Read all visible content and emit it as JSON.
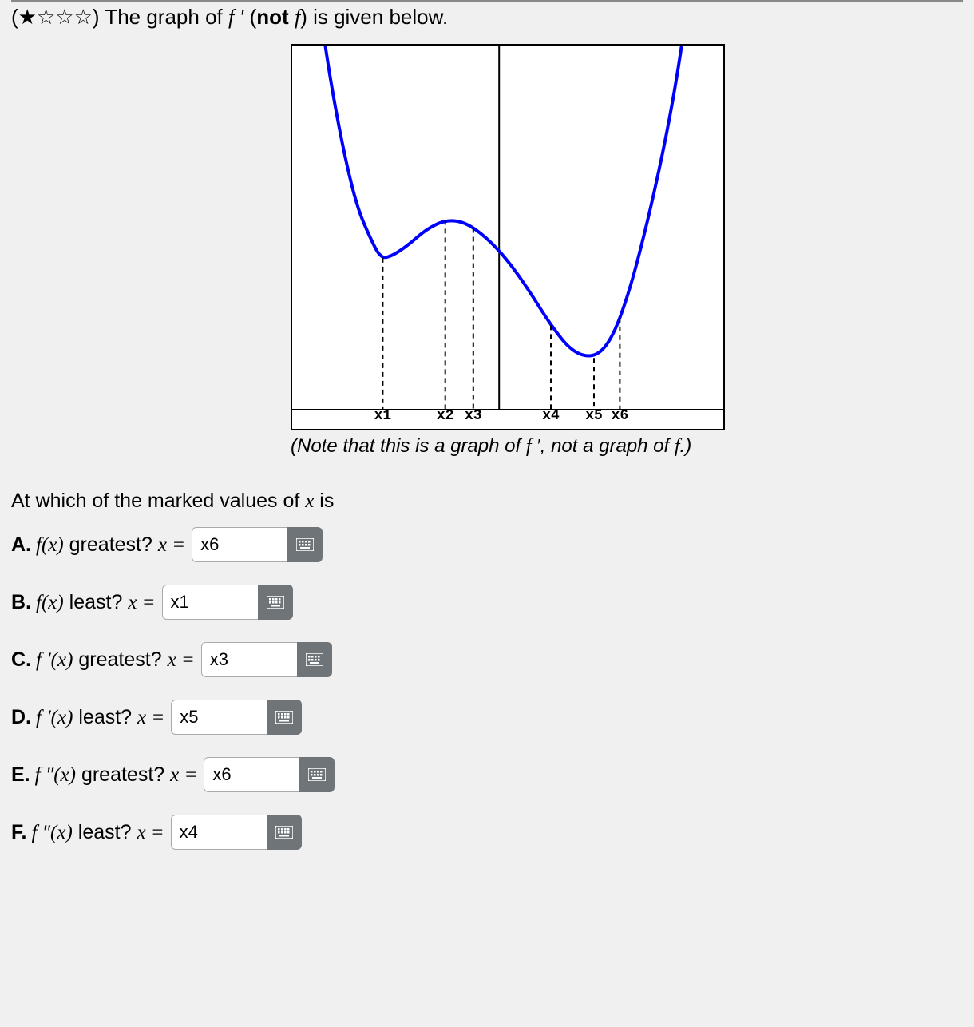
{
  "prompt": {
    "stars": "(★☆☆☆)",
    "text_pre": " The graph of ",
    "fprime": "f ′",
    "text_mid": " (",
    "not": "not",
    "text_mid2": " ",
    "f": "f",
    "text_post": ") is given below."
  },
  "caption": {
    "pre": "(Note that this is a graph of ",
    "f1": "f ′",
    "mid": ", not a graph of ",
    "f2": "f",
    "post": ".)"
  },
  "xlabels": [
    "x1",
    "x2",
    "x3",
    "x4",
    "x5",
    "x6"
  ],
  "lead": {
    "pre": "At which of the marked values of ",
    "var": "x",
    "post": " is"
  },
  "questions": [
    {
      "letter": "A.",
      "func": "f(x)",
      "ask": "greatest?",
      "eq": "x =",
      "value": "x6"
    },
    {
      "letter": "B.",
      "func": "f(x)",
      "ask": "least?",
      "eq": "x =",
      "value": "x1"
    },
    {
      "letter": "C.",
      "func": "f ′(x)",
      "ask": "greatest?",
      "eq": "x =",
      "value": "x3"
    },
    {
      "letter": "D.",
      "func": "f ′(x)",
      "ask": "least?",
      "eq": "x =",
      "value": "x5"
    },
    {
      "letter": "E.",
      "func": "f ″(x)",
      "ask": "greatest?",
      "eq": "x =",
      "value": "x6"
    },
    {
      "letter": "F.",
      "func": "f ″(x)",
      "ask": "least?",
      "eq": "x =",
      "value": "x4"
    }
  ],
  "chart_data": {
    "type": "line",
    "title": "",
    "xlabel": "",
    "ylabel": "",
    "x_marks": [
      {
        "name": "x1",
        "pos": 0.21
      },
      {
        "name": "x2",
        "pos": 0.355
      },
      {
        "name": "x3",
        "pos": 0.42
      },
      {
        "name": "x4",
        "pos": 0.6
      },
      {
        "name": "x5",
        "pos": 0.7
      },
      {
        "name": "x6",
        "pos": 0.76
      }
    ],
    "y_axis_x": 0.48,
    "x_axis_y": 0.95,
    "series": [
      {
        "name": "f'",
        "color": "#0000ff",
        "points": [
          {
            "x": 0.07,
            "y": -0.05
          },
          {
            "x": 0.09,
            "y": 0.1
          },
          {
            "x": 0.12,
            "y": 0.28
          },
          {
            "x": 0.15,
            "y": 0.42
          },
          {
            "x": 0.18,
            "y": 0.5
          },
          {
            "x": 0.205,
            "y": 0.555
          },
          {
            "x": 0.23,
            "y": 0.55
          },
          {
            "x": 0.27,
            "y": 0.52
          },
          {
            "x": 0.31,
            "y": 0.48
          },
          {
            "x": 0.355,
            "y": 0.455
          },
          {
            "x": 0.4,
            "y": 0.46
          },
          {
            "x": 0.45,
            "y": 0.5
          },
          {
            "x": 0.5,
            "y": 0.56
          },
          {
            "x": 0.55,
            "y": 0.64
          },
          {
            "x": 0.6,
            "y": 0.73
          },
          {
            "x": 0.65,
            "y": 0.8
          },
          {
            "x": 0.7,
            "y": 0.815
          },
          {
            "x": 0.74,
            "y": 0.77
          },
          {
            "x": 0.78,
            "y": 0.65
          },
          {
            "x": 0.82,
            "y": 0.48
          },
          {
            "x": 0.86,
            "y": 0.28
          },
          {
            "x": 0.89,
            "y": 0.1
          },
          {
            "x": 0.91,
            "y": -0.05
          }
        ]
      }
    ]
  }
}
